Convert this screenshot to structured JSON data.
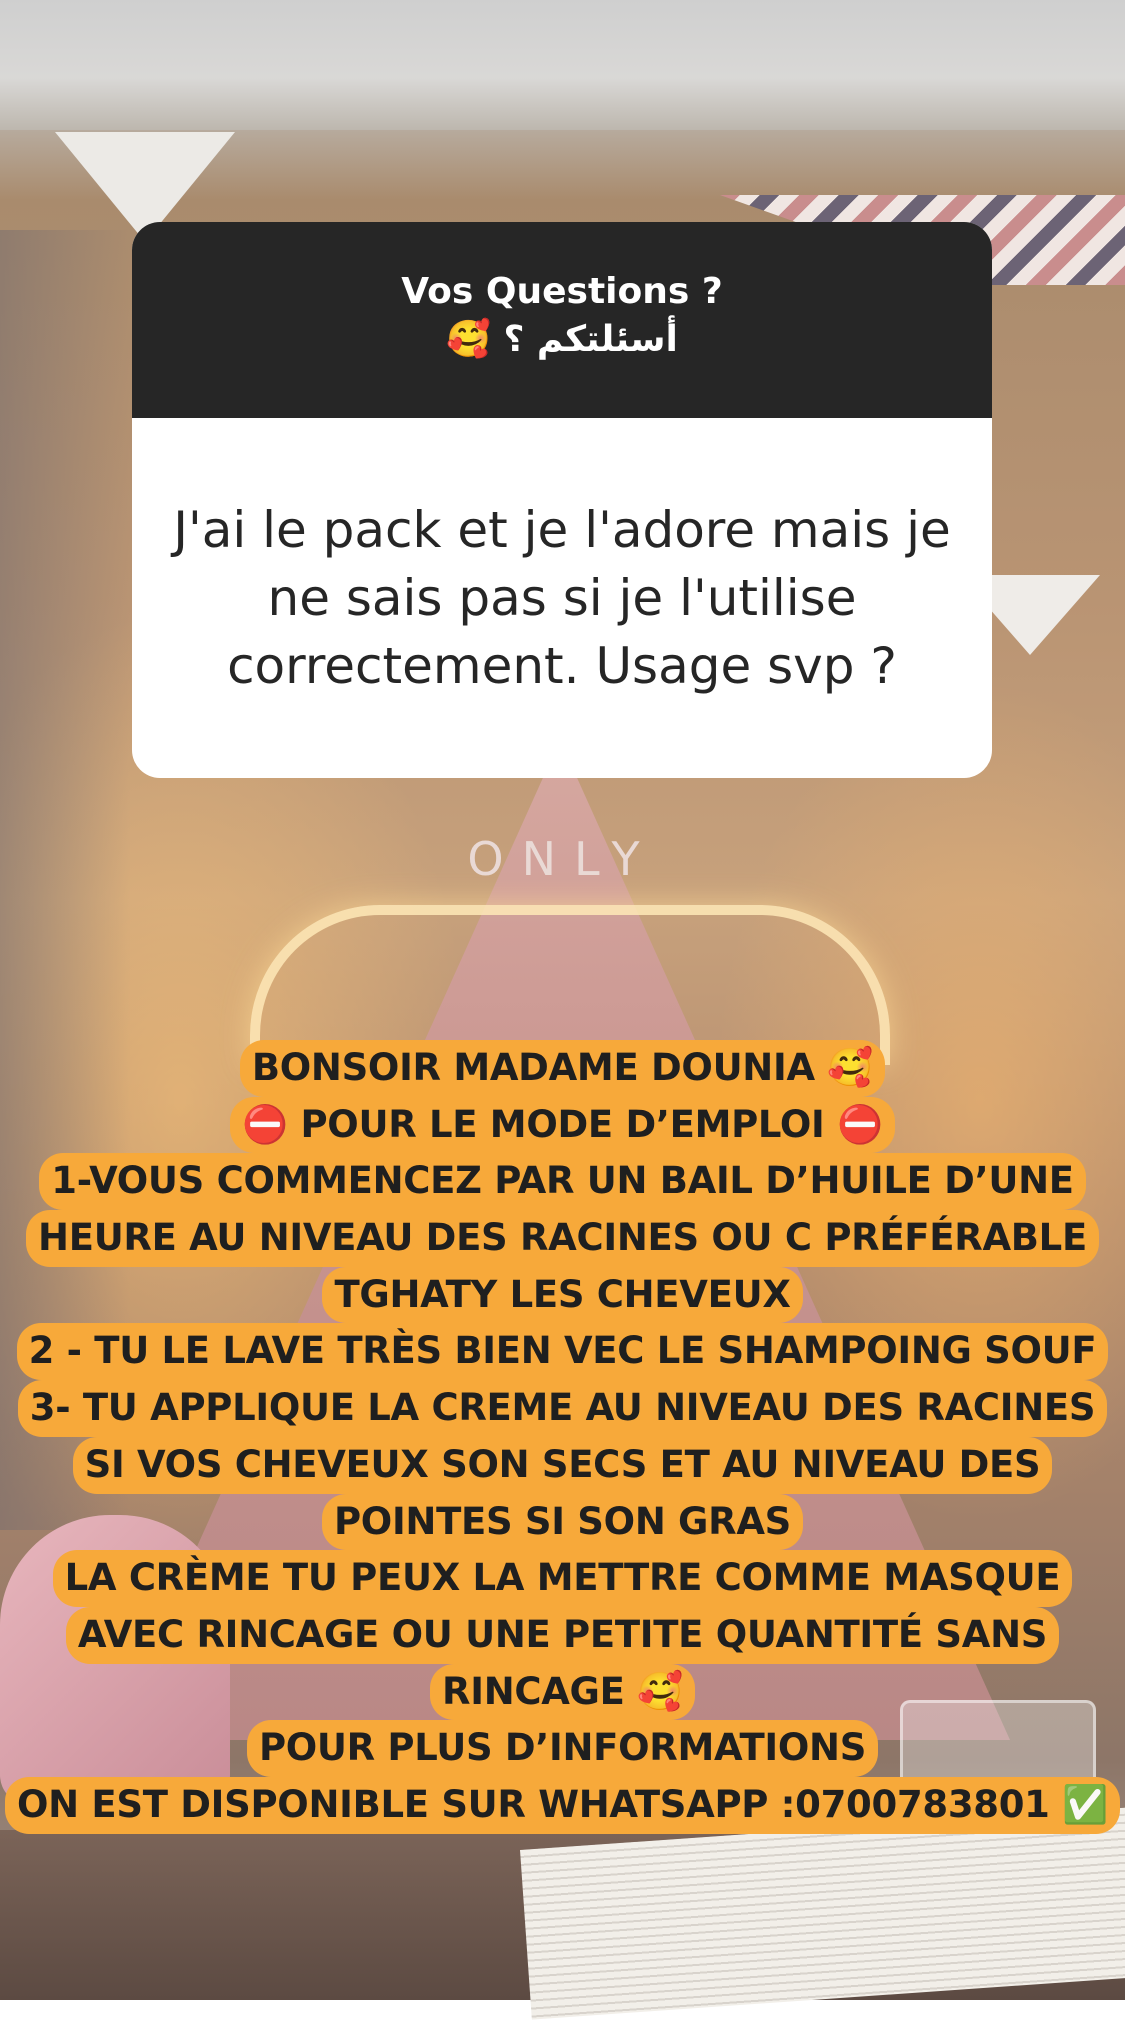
{
  "question_card": {
    "title": "Vos Questions ?",
    "subtitle": "أسئلتكم ؟ 🥰",
    "question": "J'ai le pack et je l'adore mais je ne sais pas si je l'utilise correctement. Usage svp ?"
  },
  "background": {
    "sign_word": "ONLY"
  },
  "answer": {
    "lines": [
      "BONSOIR MADAME DOUNIA 🥰",
      "⛔️ POUR LE MODE D’EMPLOI ⛔️",
      "1-VOUS COMMENCEZ PAR UN BAIL D’HUILE D’UNE",
      "HEURE AU NIVEAU DES RACINES OU C PRÉFÉRABLE",
      "TGHATY LES CHEVEUX",
      "2 - TU LE LAVE TRÈS BIEN VEC LE SHAMPOING SOUF",
      "3- TU APPLIQUE LA CREME AU NIVEAU DES RACINES",
      "SI VOS CHEVEUX SON SECS ET AU NIVEAU DES",
      "POINTES SI SON GRAS",
      "LA CRÈME TU PEUX LA METTRE COMME MASQUE",
      "AVEC RINCAGE OU UNE PETITE QUANTITÉ SANS",
      "RINCAGE 🥰",
      "POUR PLUS D’INFORMATIONS",
      "ON EST DISPONIBLE SUR WHATSAPP :0700783801 ✅"
    ]
  },
  "colors": {
    "card_header": "#262626",
    "card_body": "#ffffff",
    "highlight": "#f7a93a",
    "answer_text": "#1f1f1f"
  }
}
